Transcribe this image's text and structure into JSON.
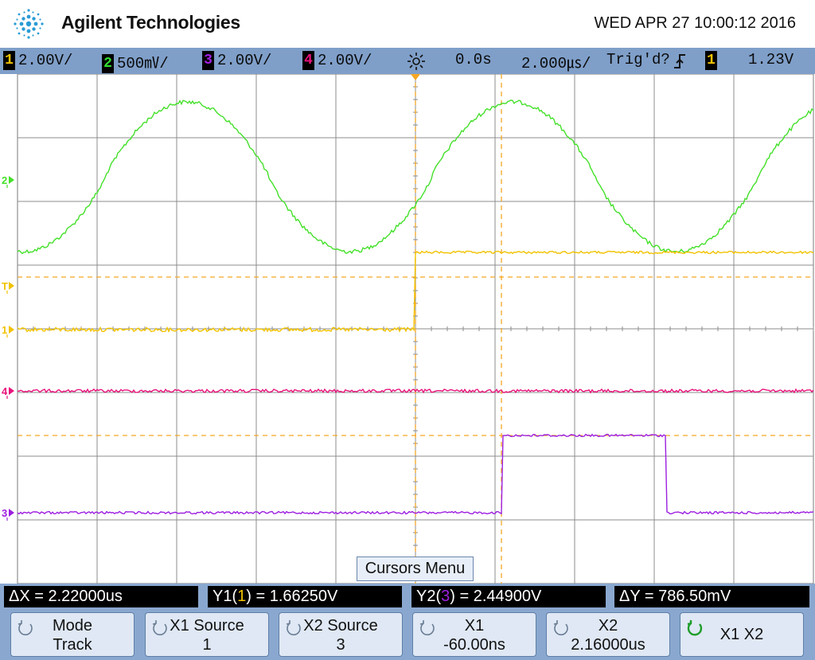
{
  "header": {
    "brand": "Agilent Technologies",
    "datetime": "WED APR 27 10:00:12 2016"
  },
  "status": {
    "ch1": {
      "num": "1",
      "scale": "2.00V/",
      "color": "#f2c200"
    },
    "ch2": {
      "num": "2",
      "scale": "500㎷/",
      "color": "#33dd33"
    },
    "ch3": {
      "num": "3",
      "scale": "2.00V/",
      "color": "#a020e0"
    },
    "ch4": {
      "num": "4",
      "scale": "2.00V/",
      "color": "#e8127c"
    },
    "delay": "0.0s",
    "timebase": "2.000㎲/",
    "trigger_state": "Trig'd?",
    "trig_source": "1",
    "trig_level": "1.23V"
  },
  "markers": {
    "ch1": "1",
    "ch2": "2",
    "ch3": "3",
    "ch4": "4",
    "trigger": "T"
  },
  "traces": {
    "ch1_color": "#f2c200",
    "ch2_color": "#44e02a",
    "ch3_color": "#9d1fe0",
    "ch4_color": "#e8127c",
    "cursor_color": "#f5a623"
  },
  "menu": {
    "title": "Cursors Menu"
  },
  "readouts": {
    "dx": "ΔX = 2.22000us",
    "y1_prefix": "Y1(",
    "y1_src": "1",
    "y1_value": ") = 1.66250V",
    "y2_prefix": "Y2(",
    "y2_src": "3",
    "y2_value": ") = 2.44900V",
    "dy": "ΔY = 786.50mV"
  },
  "softkeys": {
    "mode": {
      "line1": "Mode",
      "line2": "Track"
    },
    "x1_source": {
      "line1": "X1 Source",
      "line2": "1"
    },
    "x2_source": {
      "line1": "X2 Source",
      "line2": "3"
    },
    "x1": {
      "line1": "X1",
      "line2": "-60.00ns"
    },
    "x2": {
      "line1": "X2",
      "line2": "2.16000us"
    },
    "x1x2": {
      "label": "X1 X2"
    }
  }
}
